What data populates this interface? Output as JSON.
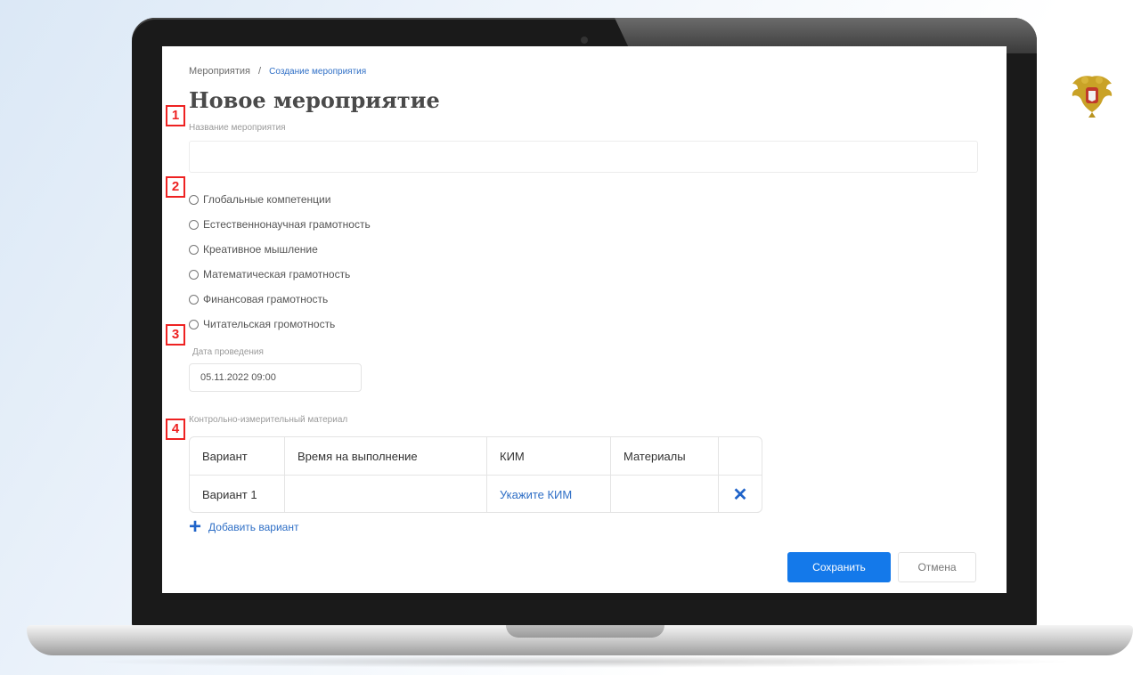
{
  "breadcrumb": {
    "root": "Мероприятия",
    "separator": "/",
    "current": "Создание мероприятия"
  },
  "page_title": "Новое мероприятие",
  "markers": [
    "1",
    "2",
    "3",
    "4"
  ],
  "name_field": {
    "label": "Название мероприятия",
    "value": ""
  },
  "competencies": [
    "Глобальные компетенции",
    "Естественнонаучная грамотность",
    "Креативное мышление",
    "Математическая грамотность",
    "Финансовая грамотность",
    "Читательская громотность"
  ],
  "date_field": {
    "label": "Дата проведения",
    "value": "05.11.2022 09:00"
  },
  "material_section": {
    "label": "Контрольно-измерительный материал",
    "columns": [
      "Вариант",
      "Время на выполнение",
      "КИМ",
      "Материалы"
    ],
    "rows": [
      {
        "variant": "Вариант 1",
        "time": "",
        "kim": "Укажите КИМ",
        "materials": "",
        "delete": "✕"
      }
    ],
    "add_label": "Добавить вариант",
    "add_icon": "+"
  },
  "actions": {
    "save": "Сохранить",
    "cancel": "Отмена"
  },
  "colors": {
    "accent": "#1479ea",
    "link": "#2f6fc6",
    "marker": "#e22222"
  }
}
